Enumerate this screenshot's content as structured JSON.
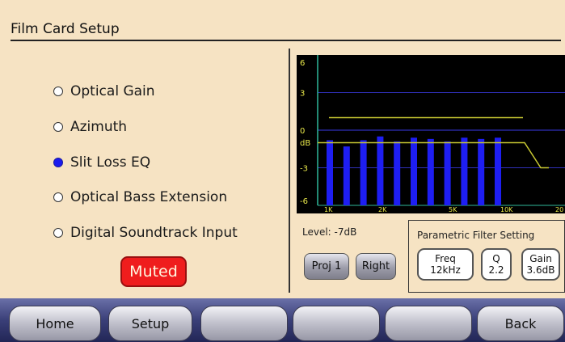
{
  "header": {
    "title": "Film Card Setup"
  },
  "options": [
    {
      "label": "Optical Gain",
      "selected": false
    },
    {
      "label": "Azimuth",
      "selected": false
    },
    {
      "label": "Slit Loss EQ",
      "selected": true
    },
    {
      "label": "Optical Bass Extension",
      "selected": false
    },
    {
      "label": "Digital Soundtrack Input",
      "selected": false
    }
  ],
  "muted_label": "Muted",
  "chart_data": {
    "type": "bar",
    "ylabel": "dB",
    "y_ticks": [
      "6",
      "3",
      "0",
      "-3",
      "-6"
    ],
    "ylim": [
      -6,
      6
    ],
    "x_ticks": [
      "1K",
      "2K",
      "5K",
      "10K",
      "20"
    ],
    "values": [
      -0.8,
      -1.3,
      -0.8,
      -0.5,
      -0.9,
      -0.6,
      -0.7,
      -0.9,
      -0.6,
      -0.7,
      -0.6
    ],
    "reference_level": 1.0,
    "response_curve_level": -1.0,
    "response_curve_rolloff_to": -3.0,
    "colors": {
      "bars": "#1e1ef2",
      "grid": "#2f2fb8",
      "curve": "#c8c832",
      "axis": "#2fb89a",
      "tick_text": "#e8e84a"
    }
  },
  "level_text": "Level: -7dB",
  "buttons": {
    "proj": "Proj 1",
    "channel": "Right"
  },
  "parametric": {
    "title": "Parametric Filter Setting",
    "freq_label": "Freq",
    "freq_value": "12kHz",
    "q_label": "Q",
    "q_value": "2.2",
    "gain_label": "Gain",
    "gain_value": "3.6dB"
  },
  "nav": [
    "Home",
    "Setup",
    "",
    "",
    "",
    "Back"
  ]
}
